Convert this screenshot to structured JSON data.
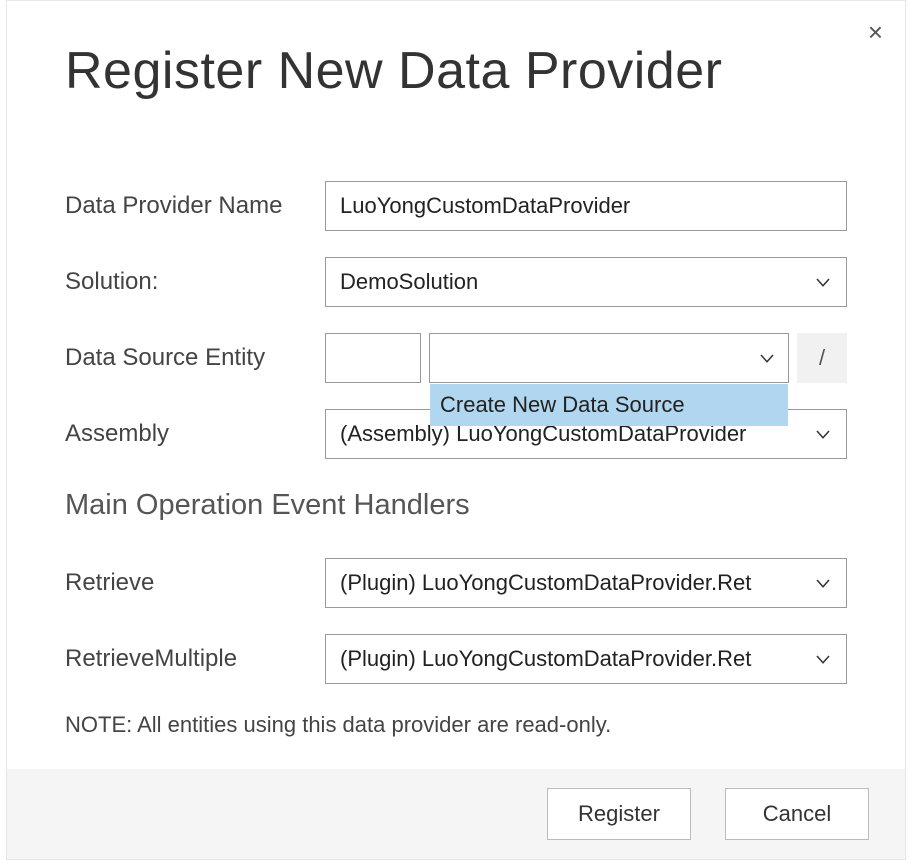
{
  "dialog": {
    "title": "Register New Data Provider",
    "close_label": "×"
  },
  "fields": {
    "provider_name_label": "Data Provider Name",
    "provider_name_value": "LuoYongCustomDataProvider",
    "solution_label": "Solution:",
    "solution_value": "DemoSolution",
    "data_source_label": "Data Source Entity",
    "data_source_prefix": "",
    "data_source_value": "",
    "slash_label": "/",
    "data_source_dropdown_item": "Create New Data Source",
    "assembly_label": "Assembly",
    "assembly_value": "(Assembly) LuoYongCustomDataProvider"
  },
  "handlers": {
    "heading": "Main Operation Event Handlers",
    "retrieve_label": "Retrieve",
    "retrieve_value": "(Plugin) LuoYongCustomDataProvider.Ret",
    "retrievemultiple_label": "RetrieveMultiple",
    "retrievemultiple_value": "(Plugin) LuoYongCustomDataProvider.Ret"
  },
  "note": "NOTE: All entities using this data provider are read-only.",
  "buttons": {
    "register": "Register",
    "cancel": "Cancel"
  }
}
